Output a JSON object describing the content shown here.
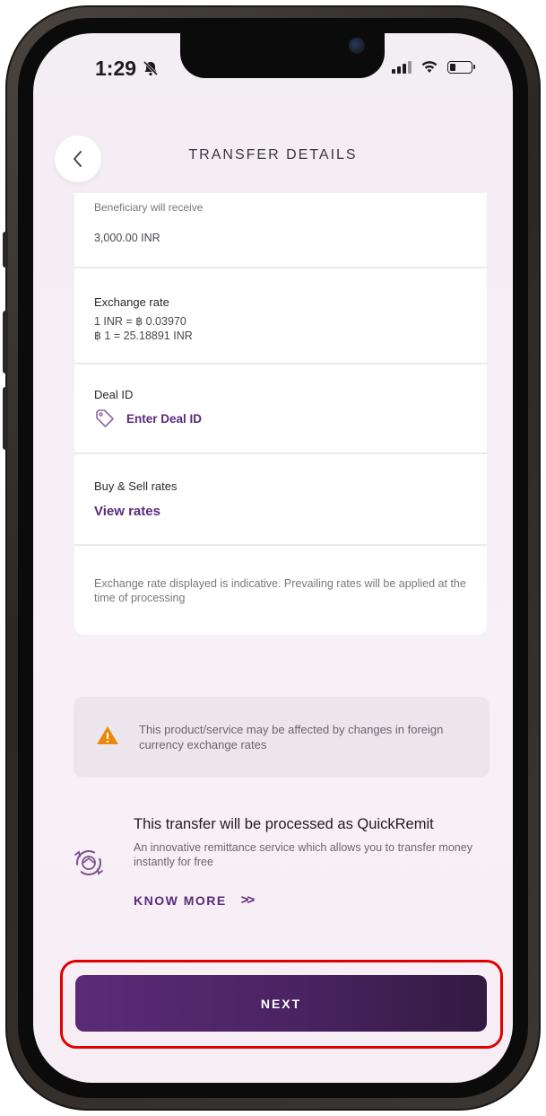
{
  "status_bar": {
    "time": "1:29"
  },
  "header": {
    "title": "TRANSFER DETAILS"
  },
  "beneficiary": {
    "label": "Beneficiary will receive",
    "amount": "3,000.00 INR"
  },
  "exchange_rate": {
    "label": "Exchange rate",
    "line1": "1 INR = ฿ 0.03970",
    "line2": "฿ 1 = 25.18891 INR"
  },
  "deal": {
    "label": "Deal ID",
    "action": "Enter Deal ID"
  },
  "buy_sell": {
    "label": "Buy & Sell rates",
    "action": "View rates"
  },
  "disclaimer": "Exchange rate displayed is indicative. Prevailing rates will be applied at the time of processing",
  "warning": "This product/service may be affected by changes in foreign currency exchange rates",
  "quickremit": {
    "title": "This transfer will be processed as QuickRemit",
    "description": "An innovative remittance service which allows you to transfer money instantly for free",
    "know_more": "KNOW MORE",
    "know_more_chevron": ">>"
  },
  "footer": {
    "next_label": "NEXT"
  },
  "colors": {
    "brand_purple": "#5a2a7a",
    "warning_orange": "#e8890c",
    "highlight_red": "#e10000"
  }
}
